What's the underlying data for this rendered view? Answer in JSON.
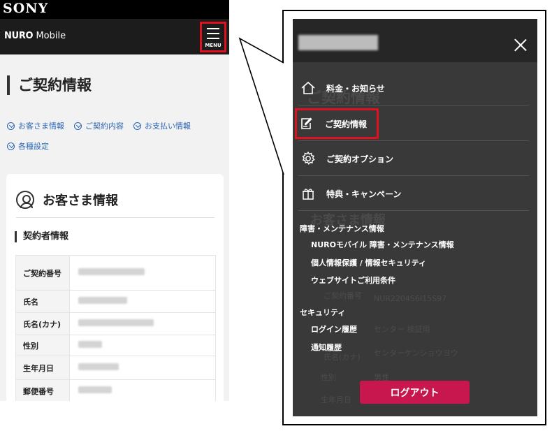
{
  "left_screen": {
    "brand": "SONY",
    "app_logo_bold": "NURO",
    "app_logo_regular": " Mobile",
    "menu_label": "MENU",
    "page_title": "ご契約情報",
    "anchor_links": [
      "お客さま情報",
      "ご契約内容",
      "お支払い情報",
      "各種設定"
    ],
    "card": {
      "title": "お客さま情報",
      "sub_heading": "契約者情報",
      "rows": [
        {
          "label": "ご契約番号",
          "value": ""
        },
        {
          "label": "氏名",
          "value": ""
        },
        {
          "label": "氏名(カナ)",
          "value": ""
        },
        {
          "label": "性別",
          "value": ""
        },
        {
          "label": "生年月日",
          "value": ""
        },
        {
          "label": "郵便番号",
          "value": ""
        }
      ]
    }
  },
  "menu_overlay": {
    "user_name": "",
    "items": [
      {
        "label": "料金・お知らせ",
        "icon": "home-icon"
      },
      {
        "label": "ご契約情報",
        "icon": "edit-icon",
        "active": true
      },
      {
        "label": "ご契約オプション",
        "icon": "gear-icon"
      },
      {
        "label": "特典・キャンペーン",
        "icon": "gift-icon"
      }
    ],
    "sections": [
      {
        "title": "障害・メンテナンス情報",
        "links": [
          "NUROモバイル 障害・メンテナンス情報",
          "個人情報保護 / 情報セキュリティ",
          "ウェブサイトご利用条件"
        ]
      },
      {
        "title": "セキュリティ",
        "links": [
          "ログイン履歴",
          "通知履歴"
        ]
      }
    ],
    "logout_label": "ログアウト",
    "background_ghost": {
      "page_title": "ご契約情報",
      "card_title": "お客さま情報",
      "row_labels": [
        "ご契約番号",
        "氏名",
        "氏名(カナ)",
        "性別",
        "生年月日"
      ],
      "row_values": [
        "NUR2204S6I15S97",
        "センター 検証用",
        "センターケンショウヨウ",
        "男性"
      ]
    }
  },
  "colors": {
    "accent_red": "#e0101e",
    "logout_pink": "#c8164e",
    "link_blue": "#2a64b4",
    "overlay_dark": "#2c2c2c"
  }
}
